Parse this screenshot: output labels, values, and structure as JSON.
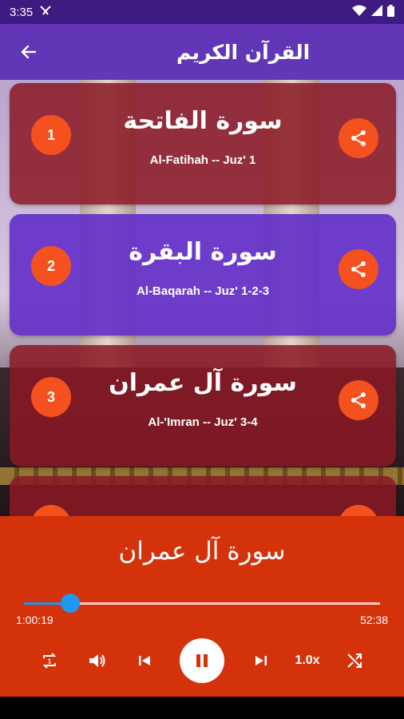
{
  "status_bar": {
    "time": "3:35"
  },
  "app_bar": {
    "title": "القرآن الكريم",
    "back_icon": "arrow-back-icon"
  },
  "surahs": [
    {
      "number": "1",
      "arabic": "سورة الفاتحة",
      "english": "Al-Fatihah -- Juz' 1",
      "color": "#8b1824"
    },
    {
      "number": "2",
      "arabic": "سورة البقرة",
      "english": "Al-Baqarah -- Juz' 1-2-3",
      "color": "#622ec8"
    },
    {
      "number": "3",
      "arabic": "سورة آل عمران",
      "english": "Al-'Imran -- Juz' 3-4",
      "color": "#8b1824"
    }
  ],
  "player": {
    "now_playing": "سورة آل عمران",
    "current_time": "1:00:19",
    "total_time": "52:38",
    "progress": 0.13,
    "speed": "1.0x",
    "accent": "#d4320b",
    "seek_color": "#2196f3"
  }
}
